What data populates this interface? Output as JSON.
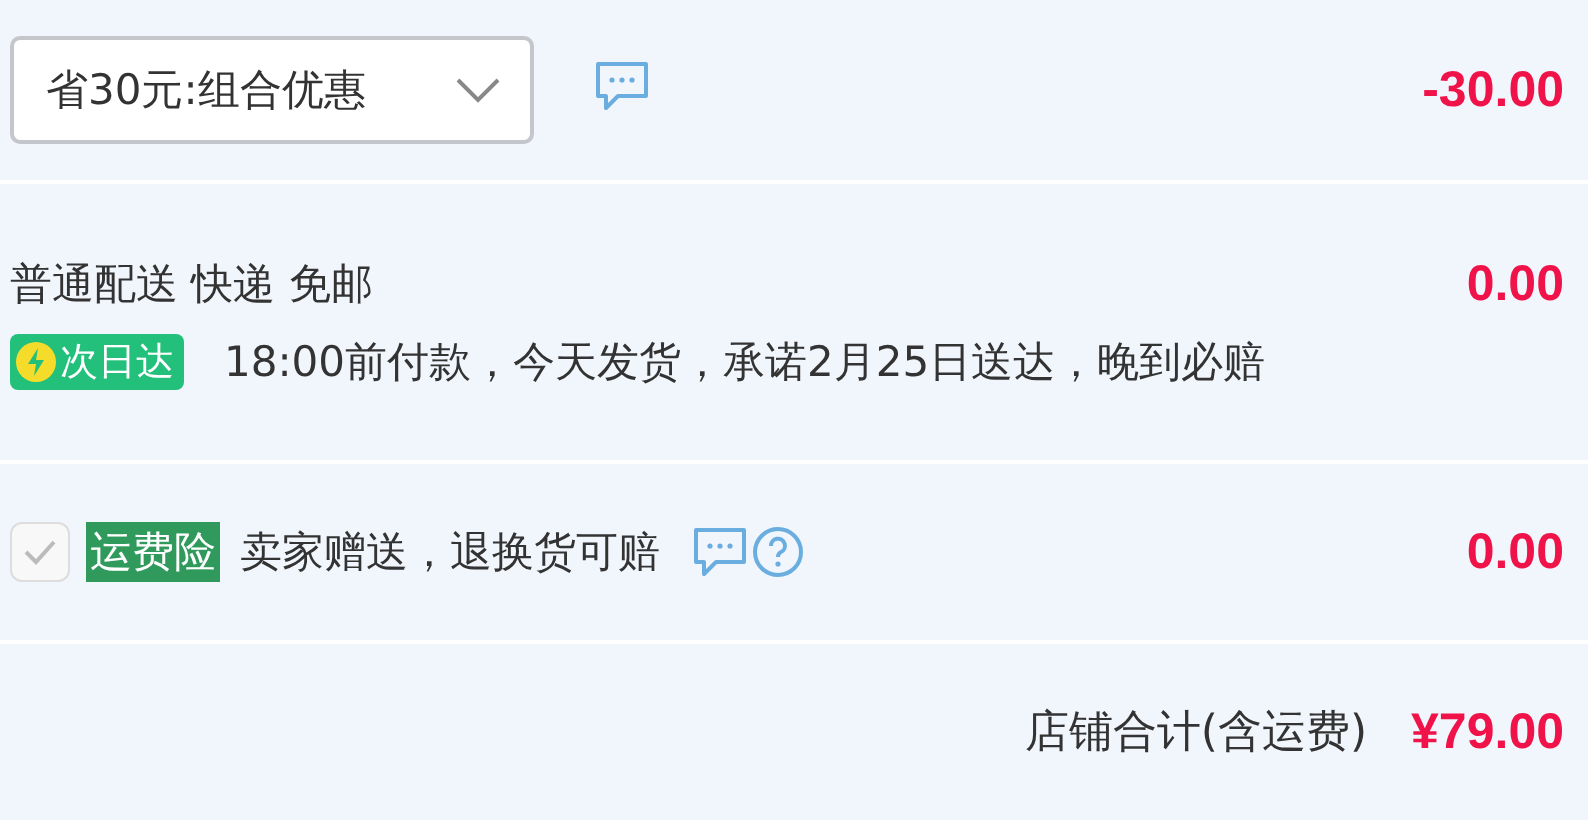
{
  "promotion": {
    "selection": "省30元:组合优惠",
    "amount": "-30.00"
  },
  "delivery": {
    "method": "普通配送 快递 免邮",
    "amount": "0.00",
    "badge": "次日达",
    "promise": "18:00前付款，今天发货，承诺2月25日送达，晚到必赔"
  },
  "insurance": {
    "checked": true,
    "tag": "运费险",
    "description": "卖家赠送，退换货可赔",
    "amount": "0.00"
  },
  "total": {
    "label": "店铺合计(含运费)",
    "amount": "¥79.00"
  }
}
